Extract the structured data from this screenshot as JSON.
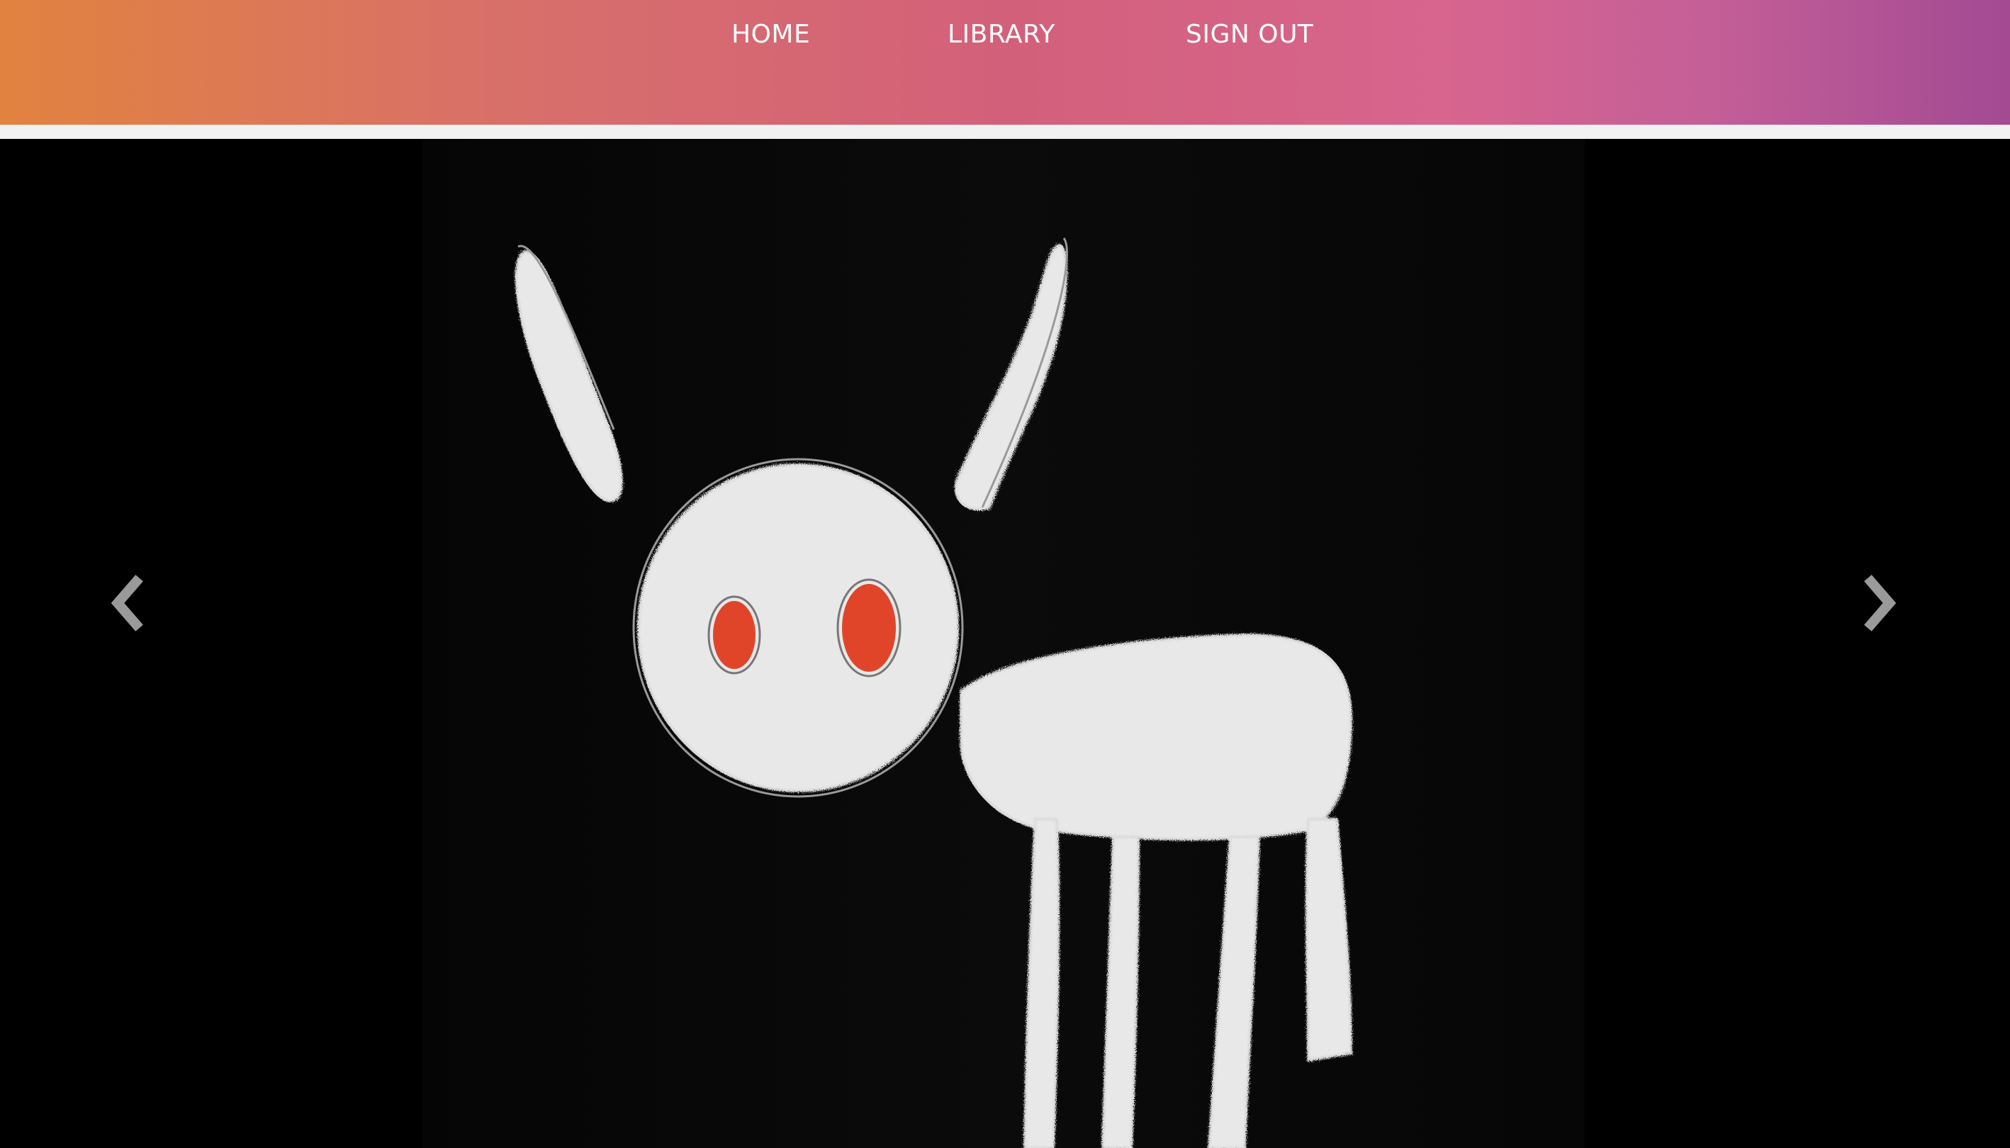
{
  "nav": {
    "items": [
      {
        "label": "HOME"
      },
      {
        "label": "LIBRARY"
      },
      {
        "label": "SIGN OUT"
      }
    ]
  },
  "carousel": {
    "slide_image": "chalk-drawing-donkey-red-eyes",
    "prev_icon": "chevron-left-icon",
    "next_icon": "chevron-right-icon"
  },
  "colors": {
    "gradient_start": "#e2823f",
    "gradient_mid": "#d3607a",
    "gradient_end": "#a34a93",
    "separator": "#f1f1f1",
    "chalk": "#e8e8e8",
    "eyes": "#e0452a"
  }
}
